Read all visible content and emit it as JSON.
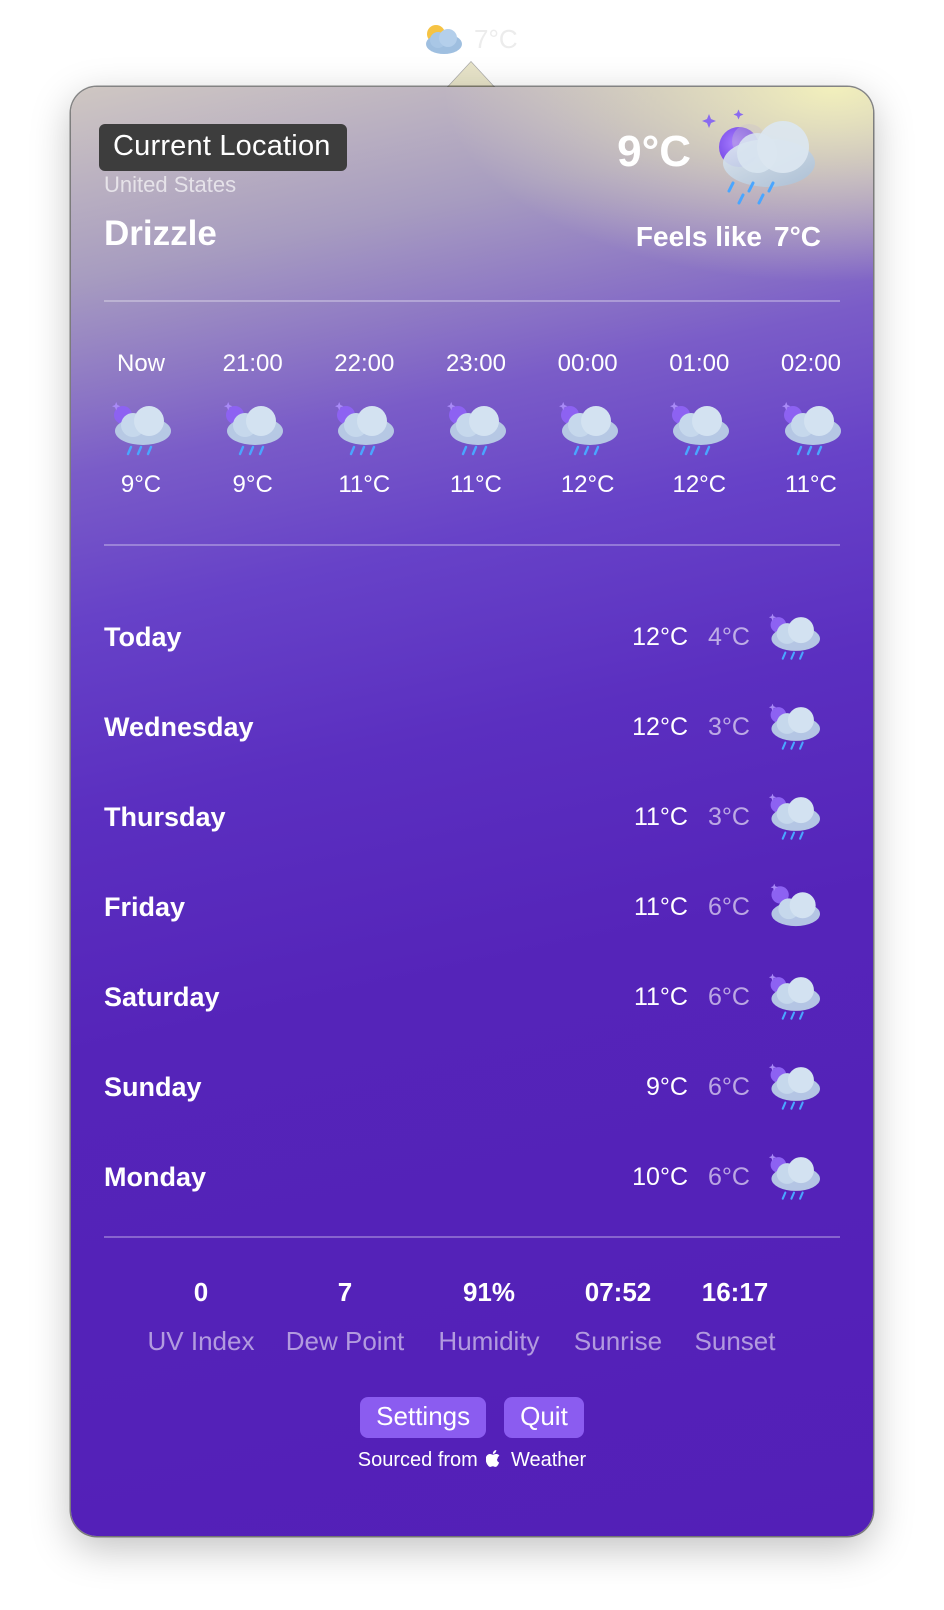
{
  "menubar": {
    "icon": "partly-cloudy-icon",
    "temp": "7°C"
  },
  "location": {
    "name": "Current Location",
    "country": "United States"
  },
  "current": {
    "condition": "Drizzle",
    "temp": "9°C",
    "feels_label": "Feels like",
    "feels_value": "7°C",
    "icon": "night-drizzle-icon"
  },
  "hourly": [
    {
      "time": "Now",
      "temp": "9°C",
      "icon": "drizzle-icon"
    },
    {
      "time": "21:00",
      "temp": "9°C",
      "icon": "drizzle-icon"
    },
    {
      "time": "22:00",
      "temp": "11°C",
      "icon": "drizzle-icon"
    },
    {
      "time": "23:00",
      "temp": "11°C",
      "icon": "drizzle-icon"
    },
    {
      "time": "00:00",
      "temp": "12°C",
      "icon": "drizzle-icon"
    },
    {
      "time": "01:00",
      "temp": "12°C",
      "icon": "drizzle-icon"
    },
    {
      "time": "02:00",
      "temp": "11°C",
      "icon": "drizzle-icon"
    }
  ],
  "daily": [
    {
      "day": "Today",
      "high": "12°C",
      "low": "4°C",
      "icon": "drizzle-icon"
    },
    {
      "day": "Wednesday",
      "high": "12°C",
      "low": "3°C",
      "icon": "drizzle-icon"
    },
    {
      "day": "Thursday",
      "high": "11°C",
      "low": "3°C",
      "icon": "drizzle-icon"
    },
    {
      "day": "Friday",
      "high": "11°C",
      "low": "6°C",
      "icon": "cloudy-night-icon"
    },
    {
      "day": "Saturday",
      "high": "11°C",
      "low": "6°C",
      "icon": "drizzle-icon"
    },
    {
      "day": "Sunday",
      "high": "9°C",
      "low": "6°C",
      "icon": "drizzle-icon"
    },
    {
      "day": "Monday",
      "high": "10°C",
      "low": "6°C",
      "icon": "drizzle-icon"
    }
  ],
  "stats": [
    {
      "value": "0",
      "label": "UV Index"
    },
    {
      "value": "7",
      "label": "Dew Point"
    },
    {
      "value": "91%",
      "label": "Humidity"
    },
    {
      "value": "07:52",
      "label": "Sunrise"
    },
    {
      "value": "16:17",
      "label": "Sunset"
    }
  ],
  "buttons": {
    "settings": "Settings",
    "quit": "Quit"
  },
  "source": {
    "prefix": "Sourced from",
    "brand": "Weather"
  }
}
